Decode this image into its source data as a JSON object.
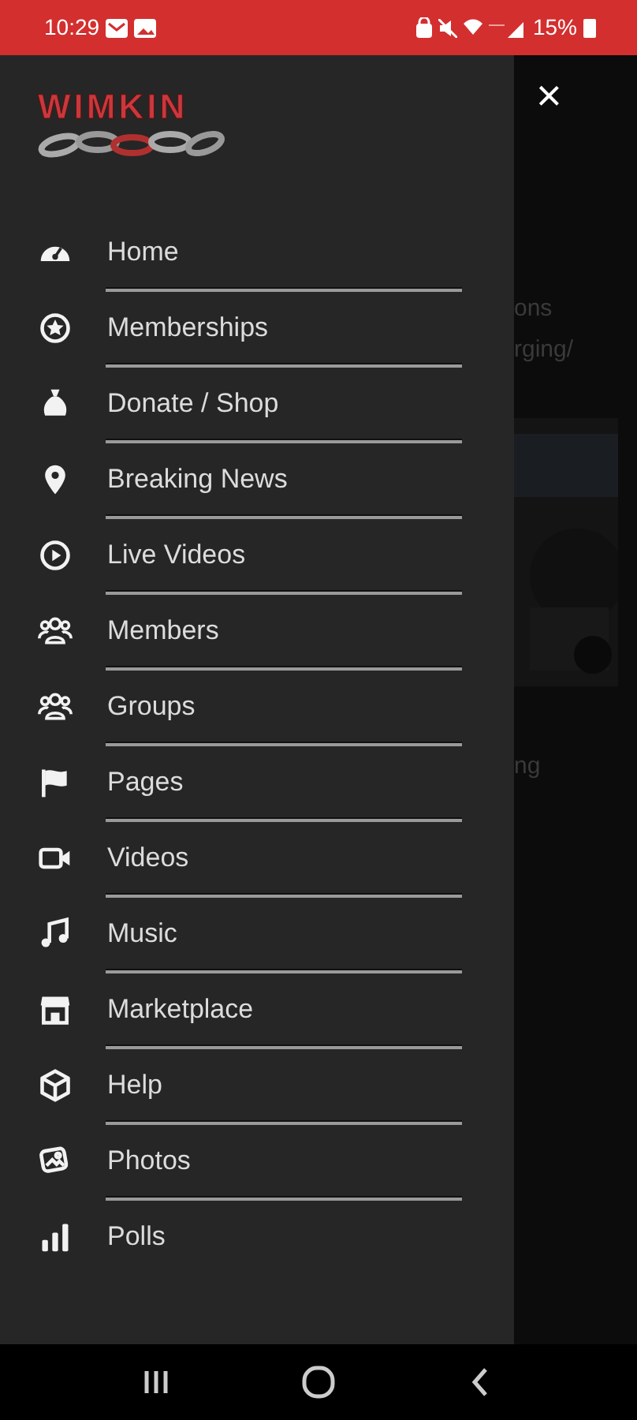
{
  "status_bar": {
    "time": "10:29",
    "battery": "15%"
  },
  "logo": {
    "text": "WIMKIN"
  },
  "close_button": {
    "label": "×"
  },
  "backdrop": {
    "fragments": [
      "ons",
      "rging/",
      "ng"
    ]
  },
  "menu": [
    {
      "label": "Home"
    },
    {
      "label": "Memberships"
    },
    {
      "label": "Donate / Shop"
    },
    {
      "label": "Breaking News"
    },
    {
      "label": "Live Videos"
    },
    {
      "label": "Members"
    },
    {
      "label": "Groups"
    },
    {
      "label": "Pages"
    },
    {
      "label": "Videos"
    },
    {
      "label": "Music"
    },
    {
      "label": "Marketplace"
    },
    {
      "label": "Help"
    },
    {
      "label": "Photos"
    },
    {
      "label": "Polls"
    }
  ]
}
